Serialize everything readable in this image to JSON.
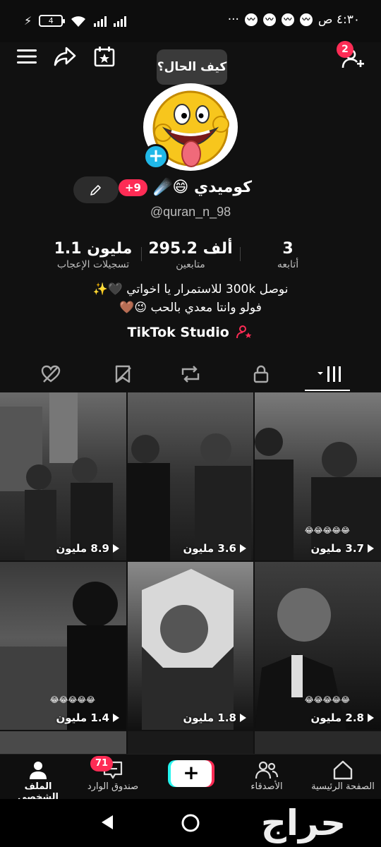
{
  "status_bar": {
    "time": "٤:٣٠ ص",
    "battery": "4",
    "dots": "···"
  },
  "header": {
    "tooltip": "كيف الحال؟",
    "follow_requests_badge": "2"
  },
  "profile": {
    "display_name": "كوميدي 😄☄️",
    "notif_badge": "9+",
    "username": "@quran_n_98",
    "stats": [
      {
        "value": "1.1 مليون",
        "label": "تسجيلات الإعجاب"
      },
      {
        "value": "295.2 ألف",
        "label": "متابعين"
      },
      {
        "value": "3",
        "label": "أتابعه"
      }
    ],
    "bio_line1": "نوصل 300k للاستمرار يا اخواتي 🖤✨",
    "bio_line2": "فولو وانتا معدي بالحب 😉🤎",
    "studio_label": "TikTok Studio"
  },
  "tabs": [
    "liked-hidden",
    "favorites-hidden",
    "reposts",
    "private",
    "videos"
  ],
  "videos": [
    {
      "views": "8.9 مليون",
      "emojis": ""
    },
    {
      "views": "3.6 مليون",
      "emojis": ""
    },
    {
      "views": "3.7 مليون",
      "emojis": "😂😂😂😂😂"
    },
    {
      "views": "1.4 مليون",
      "emojis": "😂😂😂😂😂"
    },
    {
      "views": "1.8 مليون",
      "emojis": ""
    },
    {
      "views": "2.8 مليون",
      "emojis": "😂😂😂😂😂"
    }
  ],
  "bottom_nav": {
    "home": "الصفحة الرئيسية",
    "friends": "الأصدقاء",
    "create": "+",
    "inbox": "صندوق الوارد",
    "inbox_badge": "71",
    "profile": "الملف الشخصي"
  },
  "watermark": "حراج"
}
